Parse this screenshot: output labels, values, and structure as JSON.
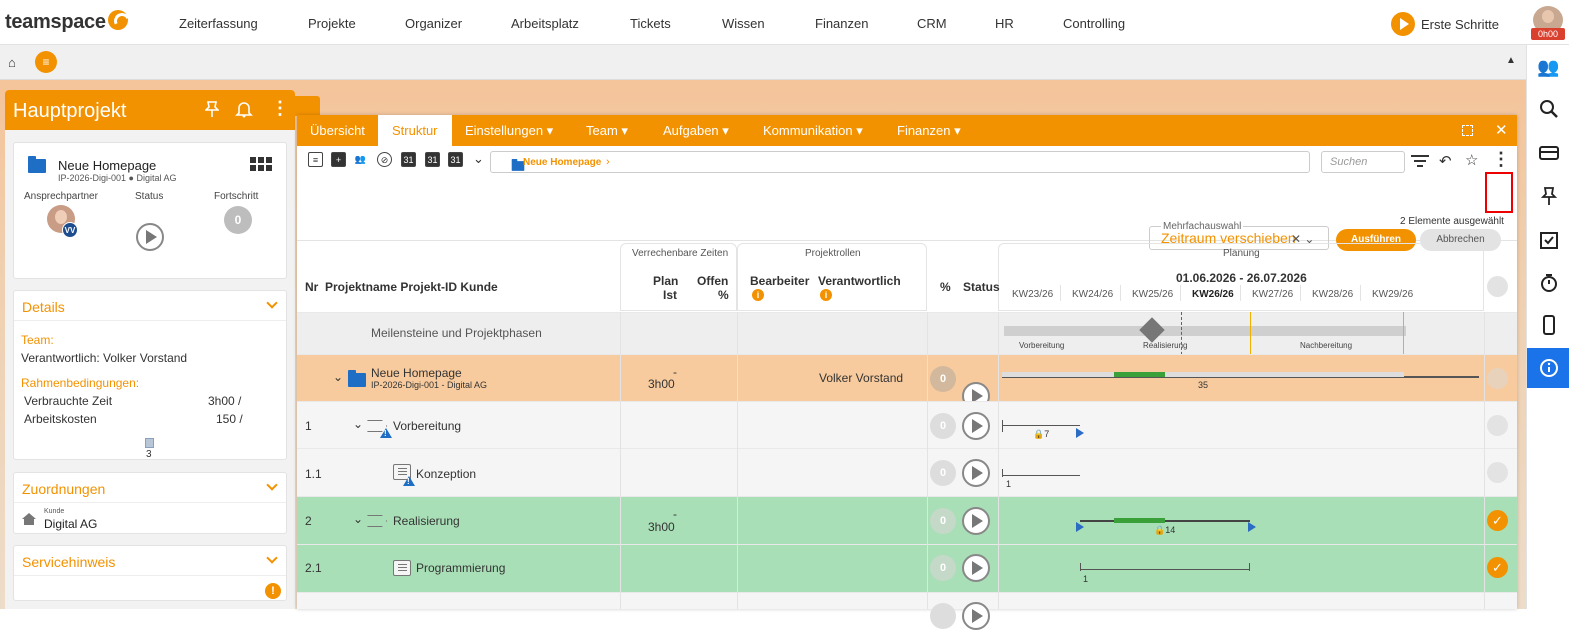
{
  "app": {
    "logo": "teamspace"
  },
  "topnav": {
    "items": [
      "Zeiterfassung",
      "Projekte",
      "Organizer",
      "Arbeitsplatz",
      "Tickets",
      "Wissen",
      "Finanzen",
      "CRM",
      "HR",
      "Controlling"
    ],
    "erste_schritte": "Erste Schritte",
    "user_time": "0h00"
  },
  "leftpanel": {
    "title": "Hauptprojekt",
    "project": {
      "name": "Neue Homepage",
      "meta": "IP-2026-Digi-001 ● Digital AG"
    },
    "labels": {
      "contact": "Ansprechpartner",
      "status": "Status",
      "progress": "Fortschritt"
    },
    "avatar_initials": "VV",
    "progress_value": "0",
    "details": {
      "title": "Details",
      "team_label": "Team:",
      "responsible": "Verantwortlich: Volker Vorstand",
      "conditions_label": "Rahmenbedingungen:",
      "rows": [
        {
          "label": "Verbrauchte Zeit",
          "value": "3h00 /"
        },
        {
          "label": "Arbeitskosten",
          "value": "150 /"
        }
      ],
      "doc_count": "3"
    },
    "zuordnungen": {
      "title": "Zuordnungen",
      "kunde_label": "Kunde",
      "kunde_value": "Digital AG"
    },
    "servicehinweis": {
      "title": "Servicehinweis"
    }
  },
  "window": {
    "tabs": [
      {
        "label": "Übersicht",
        "dropdown": false
      },
      {
        "label": "Struktur",
        "dropdown": false,
        "active": true
      },
      {
        "label": "Einstellungen",
        "dropdown": true
      },
      {
        "label": "Team",
        "dropdown": true
      },
      {
        "label": "Aufgaben",
        "dropdown": true
      },
      {
        "label": "Kommunikation",
        "dropdown": true
      },
      {
        "label": "Finanzen",
        "dropdown": true
      }
    ],
    "breadcrumb": "Neue Homepage",
    "search_placeholder": "Suchen",
    "multi": {
      "label": "Mehrfachauswahl",
      "value": "Zeitraum verschieben"
    },
    "elements_selected": "2 Elemente ausgewählt",
    "btn_run": "Ausführen",
    "btn_cancel": "Abbrechen"
  },
  "table": {
    "headers": {
      "nr": "Nr",
      "name": "Projektname Projekt-ID Kunde",
      "group_times": "Verrechenbare Zeiten",
      "plan": "Plan",
      "ist": "Ist",
      "offen": "Offen",
      "pct_small": "%",
      "group_roles": "Projektrollen",
      "bearbeiter": "Bearbeiter",
      "verantwortlich": "Verantwortlich",
      "pct": "%",
      "status": "Status",
      "planung": "Planung",
      "range": "01.06.2026 - 26.07.2026",
      "weeks": [
        "KW23/26",
        "KW24/26",
        "KW25/26",
        "KW26/26",
        "KW27/26",
        "KW28/26",
        "KW29/26"
      ]
    },
    "milestone_row": {
      "label": "Meilensteine und Projektphasen",
      "phases": [
        "Vorbereitung",
        "Realisierung",
        "Nachbereitung"
      ]
    },
    "rows": [
      {
        "nr": "",
        "name": "Neue Homepage",
        "sub": "IP-2026-Digi-001 - Digital AG",
        "plan": "-",
        "ist": "3h00",
        "verantwortlich": "Volker Vorstand",
        "pct": "0",
        "gantt_label": "35"
      },
      {
        "nr": "1",
        "name": "Vorbereitung",
        "pct": "0",
        "gantt_label": "7"
      },
      {
        "nr": "1.1",
        "name": "Konzeption",
        "pct": "0",
        "gantt_label": "1"
      },
      {
        "nr": "2",
        "name": "Realisierung",
        "plan": "-",
        "ist": "3h00",
        "pct": "0",
        "gantt_label": "14"
      },
      {
        "nr": "2.1",
        "name": "Programmierung",
        "pct": "0",
        "gantt_label": "1"
      }
    ]
  },
  "colors": {
    "accent": "#f39200",
    "highlight_row": "#f8cb9e",
    "green_row": "#a9dfb7",
    "blue": "#1a73e8"
  }
}
